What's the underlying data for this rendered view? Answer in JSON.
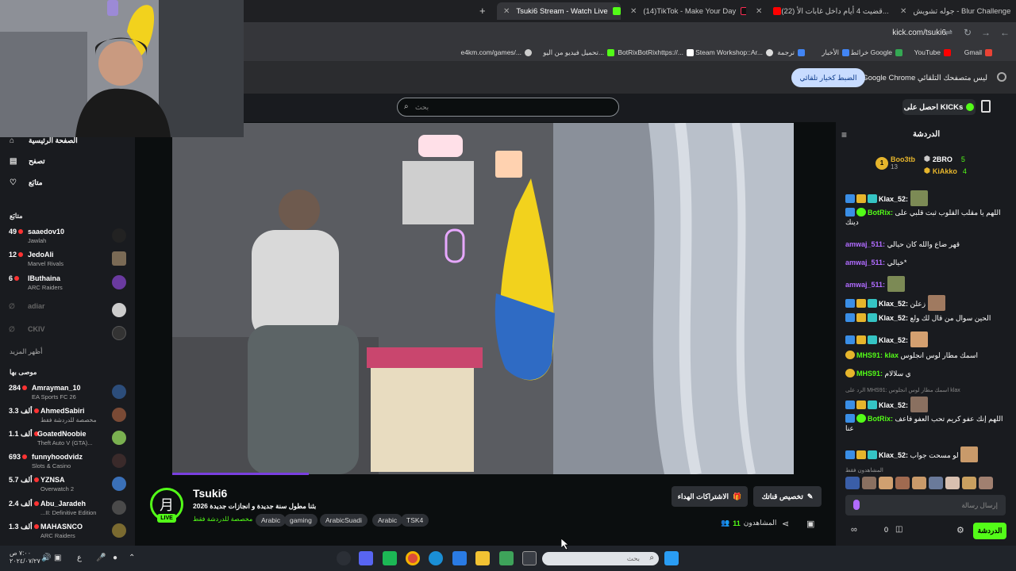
{
  "browser": {
    "tabs": [
      {
        "title": "جوله تشويش - Blur Challenge",
        "active": false
      },
      {
        "title": "(22) قضيت 4 أيام داخل غابات الأ...",
        "active": false
      },
      {
        "title": "(14)TikTok - Make Your Day",
        "active": false
      },
      {
        "title": "Tsuki6 Stream - Watch Live",
        "active": true
      }
    ],
    "new_tab": "+",
    "url": "kick.com/tsuki6",
    "bookmarks": [
      "Gmail",
      "YouTube",
      "خرائط Google",
      "الأخبار",
      "ترجمة",
      "Steam Workshop::Ar...",
      "BotRixBotRixhttps://...",
      "تحميل فيديو من اليو...",
      "e4km.com/games/..."
    ],
    "infobar": {
      "text": "Google Chrome ليس متصفحك التلقائي",
      "button": "الضبط كخيار تلقائي"
    }
  },
  "topnav": {
    "search_placeholder": "بحث",
    "kicks_label": "احصل على KICKs"
  },
  "sidebar": {
    "nav": [
      {
        "label": "الصفحة الرئيسية",
        "icon": "home-icon"
      },
      {
        "label": "تصفح",
        "icon": "browse-icon"
      },
      {
        "label": "متابَع",
        "icon": "heart-icon"
      }
    ],
    "following_header": "متابَع",
    "following": [
      {
        "count": "49",
        "name": "saaedov10",
        "category": "Jawlah",
        "live": true
      },
      {
        "count": "12",
        "name": "JedoAli",
        "category": "Marvel Rivals",
        "live": true
      },
      {
        "count": "6",
        "name": "IButhaina",
        "category": "ARC Raiders",
        "live": true
      },
      {
        "count": "",
        "name": "adiar",
        "category": "",
        "live": false
      },
      {
        "count": "",
        "name": "CKIV",
        "category": "",
        "live": false
      }
    ],
    "show_more": "أظهر المزيد",
    "recommended_header": "موصى بها",
    "recommended": [
      {
        "count": "284",
        "name": "Amrayman_10",
        "category": "EA Sports FC 26"
      },
      {
        "count": "3.3 ألف",
        "name": "AhmedSabiri",
        "category": "مخصصة للدردشة فقط"
      },
      {
        "count": "1.1 ألف",
        "name": "GoatedNoobie",
        "category": "Theft Auto V (GTA)..."
      },
      {
        "count": "693",
        "name": "funnyhoodvidz",
        "category": "Slots & Casino"
      },
      {
        "count": "5.7 ألف",
        "name": "YZNSA",
        "category": "Overwatch 2"
      },
      {
        "count": "2.4 ألف",
        "name": "Abu_Jaradeh",
        "category": "...II: Definitive Edition"
      },
      {
        "count": "1.3 ألف",
        "name": "MAHASNCO",
        "category": "ARC Raiders"
      }
    ]
  },
  "stream": {
    "streamer": "Tsuki6",
    "live_label": "LIVE",
    "title": "بثنا مطول سنة جديدة و انجازات جديدة  2026",
    "category": "مخصصة للدردشة فقط",
    "tags": [
      "Arabic",
      "gaming",
      "ArabicSuadi",
      "Arabic",
      "TSK4"
    ],
    "gift_button": "الاشتراكات الهداء",
    "customize_button": "تخصيص قناتك",
    "viewers_label": "المشاهدون",
    "viewers_count": "11"
  },
  "chat": {
    "title": "الدردشة",
    "leaderboard": [
      {
        "rank": "1",
        "name": "Boo3tb",
        "value": "13"
      },
      {
        "rank": "",
        "name": "2BRO",
        "value": "5"
      },
      {
        "rank": "",
        "name": "KiAkko",
        "value": "4"
      }
    ],
    "messages": [
      {
        "user": "Klax_52:",
        "text": "",
        "color": "#b06bff",
        "emote": true
      },
      {
        "user": "BotRix:",
        "text": "اللهم يا مقلب القلوب ثبت قلبي على دينك",
        "color": "#53fc18",
        "emote": false
      },
      {
        "user": "amwaj_511:",
        "text": "قهر ضاع والله كان حيالي",
        "color": "#b06bff",
        "emote": false
      },
      {
        "user": "amwaj_511:",
        "text": "خيالي*",
        "color": "#b06bff",
        "emote": false
      },
      {
        "user": "amwaj_511:",
        "text": "",
        "color": "#b06bff",
        "emote": true
      },
      {
        "user": "Klax_52:",
        "text": "زعلن",
        "color": "#b06bff",
        "emote": true
      },
      {
        "user": "Klax_52:",
        "text": "الحين سوال من قال لك ولع",
        "color": "#b06bff",
        "emote": false
      },
      {
        "user": "Klax_52:",
        "text": "",
        "color": "#b06bff",
        "emote": true
      },
      {
        "user": "MHS91: klax",
        "text": "اسمك مطار لوس انجلوس",
        "color": "#53fc18",
        "emote": false
      },
      {
        "user": "MHS91:",
        "text": "ي سلالام",
        "color": "#53fc18",
        "emote": false
      },
      {
        "user": "Klax_52:",
        "text": "",
        "color": "#b06bff",
        "emote": true
      },
      {
        "user": "BotRix:",
        "text": "اللهم إنك عفو كريم تحب العفو فاعف عنا",
        "color": "#53fc18",
        "emote": false
      },
      {
        "user": "Klax_52:",
        "text": "لو مسحت جواب",
        "color": "#b06bff",
        "emote": true
      }
    ],
    "reply_hint": "الرد على MHS91: اسمك مطار لوس انجلوس klax",
    "viewers_strip_label": "المشاهدون فقط",
    "input_placeholder": "إرسال رسالة",
    "send_label": "الدردشة",
    "points": "0"
  },
  "taskbar": {
    "search_placeholder": "بحث",
    "time": "٧:٠٠ ص",
    "date": "٢٠٢٤/٠٧/٢٧",
    "lang": "ع"
  }
}
